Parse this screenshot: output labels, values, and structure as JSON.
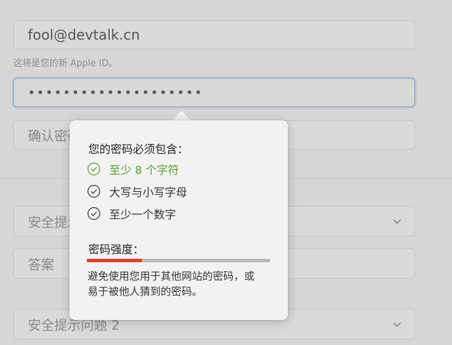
{
  "form": {
    "email_value": "fool@devtalk.cn",
    "email_hint": "这将是您的新 Apple ID。",
    "password_value": "••••••••••••••••••••",
    "confirm_placeholder": "确认密码",
    "question1": "安全提示问题 1",
    "answer1_placeholder": "答案",
    "question2": "安全提示问题 2"
  },
  "popover": {
    "title": "您的密码必须包含：",
    "requirements": [
      {
        "label": "至少 8 个字符",
        "met": true
      },
      {
        "label": "大写与小写字母",
        "met": false
      },
      {
        "label": "至少一个数字",
        "met": false
      }
    ],
    "strength_label": "密码强度：",
    "strength_level": 0.3,
    "advice": "避免使用您用于其他网站的密码，或易于被他人猜到的密码。"
  },
  "colors": {
    "met": "#5a9a2c",
    "strength": "#d9432d"
  },
  "icons": {
    "requirement_icon": "check-circle-icon",
    "select_icon": "chevron-down-icon"
  }
}
